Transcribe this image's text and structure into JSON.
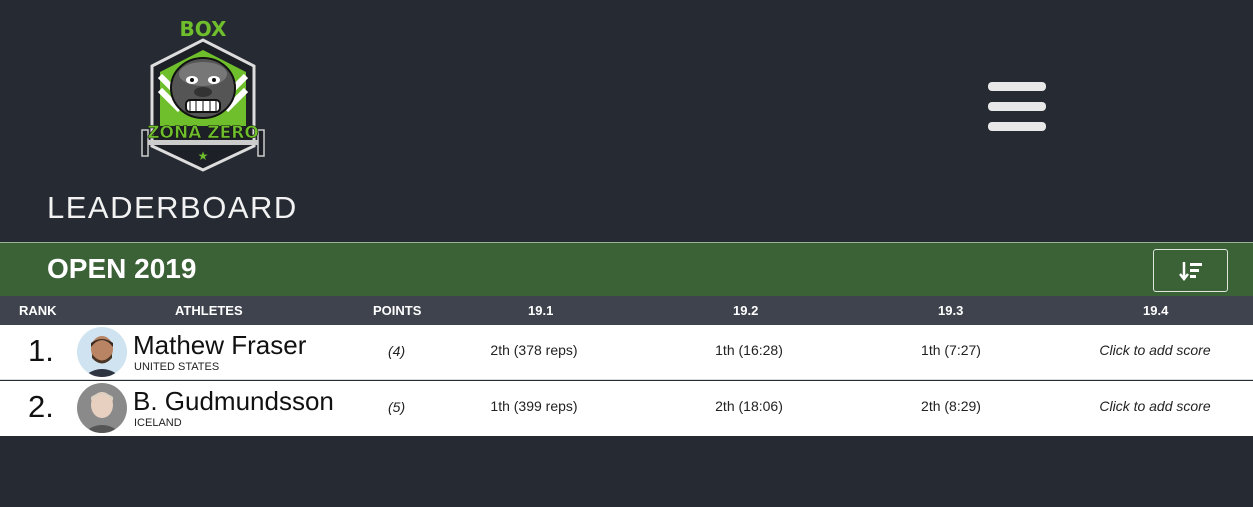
{
  "header": {
    "logo": {
      "top_text": "BOX",
      "bottom_text": "ZONA ZERO",
      "name": "box-zona-zero-gorilla-logo"
    },
    "title": "LEADERBOARD",
    "menu_icon": "hamburger-icon"
  },
  "competition": {
    "title": "OPEN 2019",
    "sort_icon": "sort-descending-icon"
  },
  "columns": {
    "rank": "RANK",
    "athletes": "ATHLETES",
    "points": "POINTS",
    "w1": "19.1",
    "w2": "19.2",
    "w3": "19.3",
    "w4": "19.4"
  },
  "rows": [
    {
      "rank": "1.",
      "name": "Mathew Fraser",
      "country": "UNITED STATES",
      "points": "(4)",
      "w1": "2th (378 reps)",
      "w2": "1th (16:28)",
      "w3": "1th (7:27)",
      "w4": "Click to add score"
    },
    {
      "rank": "2.",
      "name": "B. Gudmundsson",
      "country": "ICELAND",
      "points": "(5)",
      "w1": "1th (399 reps)",
      "w2": "2th (18:06)",
      "w3": "2th (8:29)",
      "w4": "Click to add score"
    }
  ],
  "colors": {
    "background": "#262a33",
    "competition_bar": "#3b6137",
    "column_header": "#3f434d",
    "logo_green": "#6fbe2c"
  }
}
